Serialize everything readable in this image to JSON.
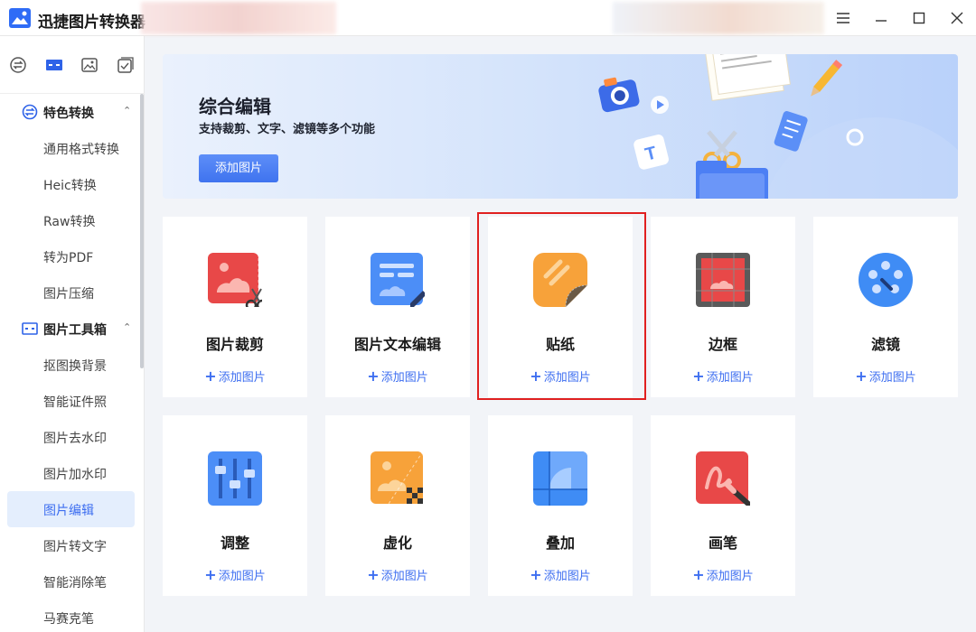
{
  "app": {
    "title": "迅捷图片转换器"
  },
  "window_controls": [
    "menu-icon",
    "minimize-icon",
    "maximize-icon",
    "close-icon"
  ],
  "sidebar": {
    "top_icons": [
      "convert-icon",
      "toolbox-icon",
      "image-icon",
      "check-icon"
    ],
    "sections": [
      {
        "label": "特色转换",
        "expanded": true,
        "items": [
          "通用格式转换",
          "Heic转换",
          "Raw转换",
          "转为PDF",
          "图片压缩"
        ]
      },
      {
        "label": "图片工具箱",
        "expanded": true,
        "items": [
          "抠图换背景",
          "智能证件照",
          "图片去水印",
          "图片加水印",
          "图片编辑",
          "图片转文字",
          "智能消除笔",
          "马赛克笔"
        ]
      }
    ],
    "active_item": "图片编辑"
  },
  "banner": {
    "title": "综合编辑",
    "subtitle": "支持裁剪、文字、滤镜等多个功能",
    "button": "添加图片"
  },
  "tools": [
    {
      "name": "图片裁剪",
      "action": "添加图片",
      "icon": "crop-icon"
    },
    {
      "name": "图片文本编辑",
      "action": "添加图片",
      "icon": "text-edit-icon"
    },
    {
      "name": "贴纸",
      "action": "添加图片",
      "icon": "sticker-icon",
      "selected": true
    },
    {
      "name": "边框",
      "action": "添加图片",
      "icon": "border-icon"
    },
    {
      "name": "滤镜",
      "action": "添加图片",
      "icon": "filter-icon"
    },
    {
      "name": "调整",
      "action": "添加图片",
      "icon": "adjust-icon"
    },
    {
      "name": "虚化",
      "action": "添加图片",
      "icon": "blur-icon"
    },
    {
      "name": "叠加",
      "action": "添加图片",
      "icon": "overlay-icon"
    },
    {
      "name": "画笔",
      "action": "添加图片",
      "icon": "brush-icon"
    }
  ],
  "colors": {
    "accent": "#3d6ef0",
    "selection": "#e02020",
    "active_bg": "#e4eefd"
  }
}
